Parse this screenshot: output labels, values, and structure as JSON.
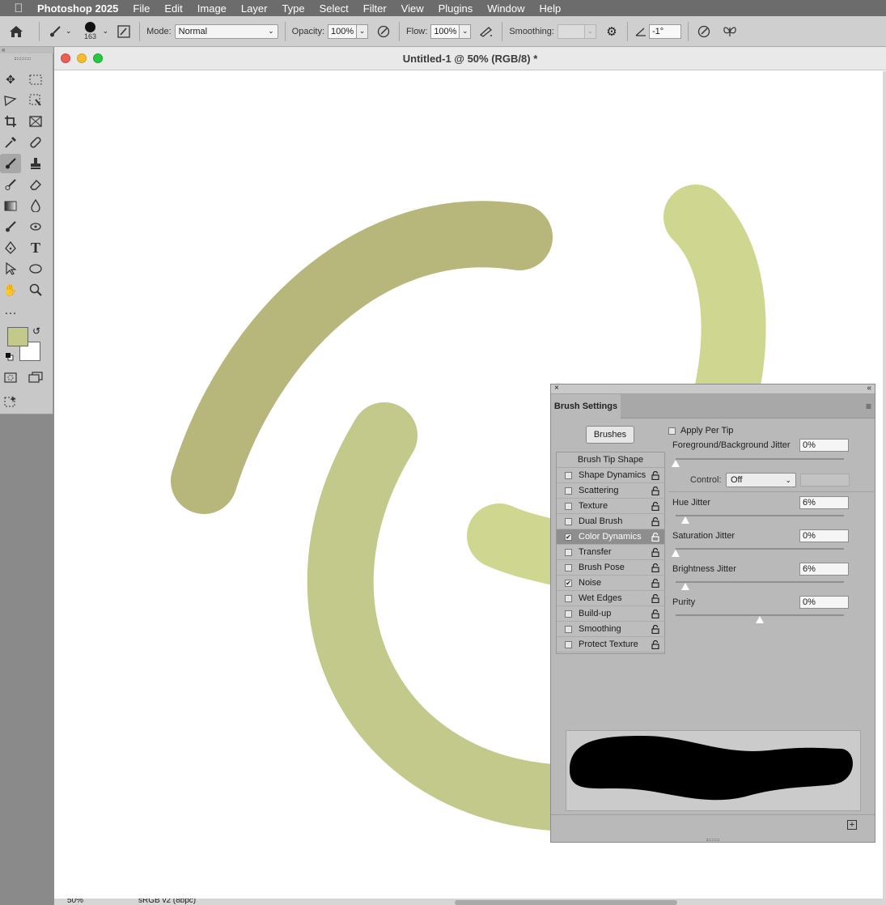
{
  "menubar": {
    "app_name": "Photoshop 2025",
    "items": [
      "File",
      "Edit",
      "Image",
      "Layer",
      "Type",
      "Select",
      "Filter",
      "View",
      "Plugins",
      "Window",
      "Help"
    ]
  },
  "options_bar": {
    "brush_size": "163",
    "mode_label": "Mode:",
    "mode_value": "Normal",
    "opacity_label": "Opacity:",
    "opacity_value": "100%",
    "flow_label": "Flow:",
    "flow_value": "100%",
    "smoothing_label": "Smoothing:",
    "smoothing_value": "",
    "angle_value": "-1°"
  },
  "document": {
    "title": "Untitled-1 @ 50% (RGB/8) *",
    "status_zoom": "50%",
    "status_profile": "sRGB v2 (8bpc)"
  },
  "colors": {
    "foreground": "#c2c98b",
    "background": "#ffffff",
    "stroke_dark": "#b7b77c",
    "stroke_mid": "#c3c98a",
    "stroke_light": "#cfd690"
  },
  "brush_settings": {
    "tab_label": "Brush Settings",
    "brushes_button": "Brushes",
    "tip_shape_label": "Brush Tip Shape",
    "items": [
      {
        "label": "Shape Dynamics",
        "checked": false
      },
      {
        "label": "Scattering",
        "checked": false
      },
      {
        "label": "Texture",
        "checked": false
      },
      {
        "label": "Dual Brush",
        "checked": false
      },
      {
        "label": "Color Dynamics",
        "checked": true,
        "selected": true
      },
      {
        "label": "Transfer",
        "checked": false
      },
      {
        "label": "Brush Pose",
        "checked": false
      },
      {
        "label": "Noise",
        "checked": true
      },
      {
        "label": "Wet Edges",
        "checked": false
      },
      {
        "label": "Build-up",
        "checked": false
      },
      {
        "label": "Smoothing",
        "checked": false
      },
      {
        "label": "Protect Texture",
        "checked": false
      }
    ],
    "apply_per_tip": "Apply Per Tip",
    "fg_bg_jitter_label": "Foreground/Background Jitter",
    "fg_bg_jitter_value": "0%",
    "control_label": "Control:",
    "control_value": "Off",
    "hue_jitter_label": "Hue Jitter",
    "hue_jitter_value": "6%",
    "saturation_jitter_label": "Saturation Jitter",
    "saturation_jitter_value": "0%",
    "brightness_jitter_label": "Brightness Jitter",
    "brightness_jitter_value": "6%",
    "purity_label": "Purity",
    "purity_value": "0%"
  }
}
